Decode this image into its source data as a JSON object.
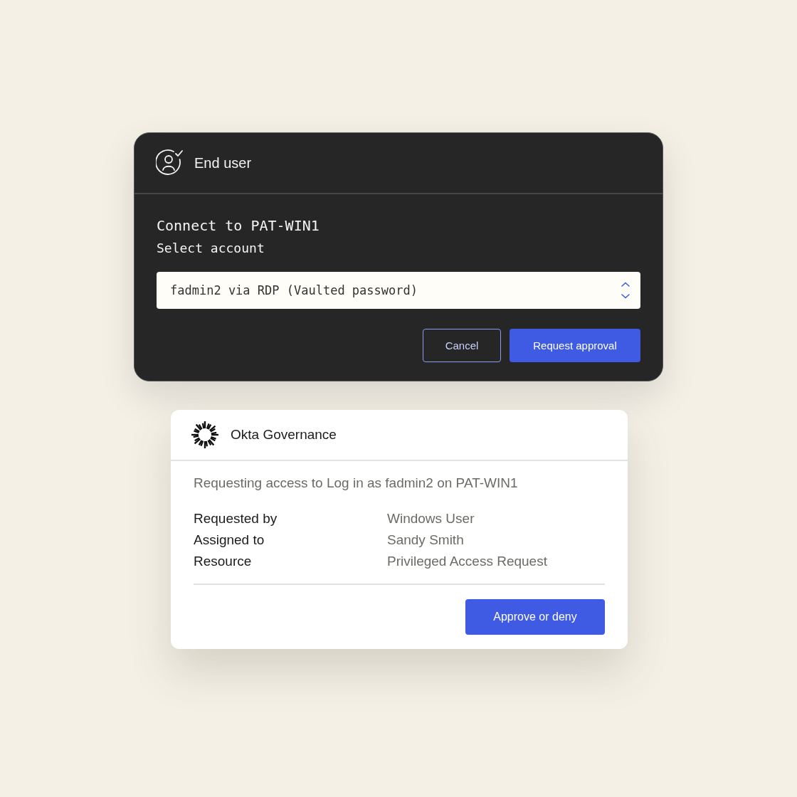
{
  "session_card": {
    "title": "End user",
    "heading": "Connect to PAT-WIN1",
    "field_label": "Select account",
    "account_select": {
      "value": "fadmin2 via RDP (Vaulted password)"
    },
    "buttons": [
      {
        "label": "Cancel",
        "kind": "secondary"
      },
      {
        "label": "Request approval",
        "kind": "primary"
      }
    ]
  },
  "approval_card": {
    "title": "Okta Governance",
    "summary": "Requesting access to Log in as fadmin2 on PAT-WIN1",
    "details": [
      {
        "label": "Requested by",
        "value": "Windows User"
      },
      {
        "label": "Assigned to",
        "value": "Sandy Smith"
      },
      {
        "label": "Resource",
        "value": "Privileged Access Request"
      }
    ],
    "buttons": [
      {
        "label": "Approve or deny",
        "kind": "primary"
      }
    ]
  }
}
